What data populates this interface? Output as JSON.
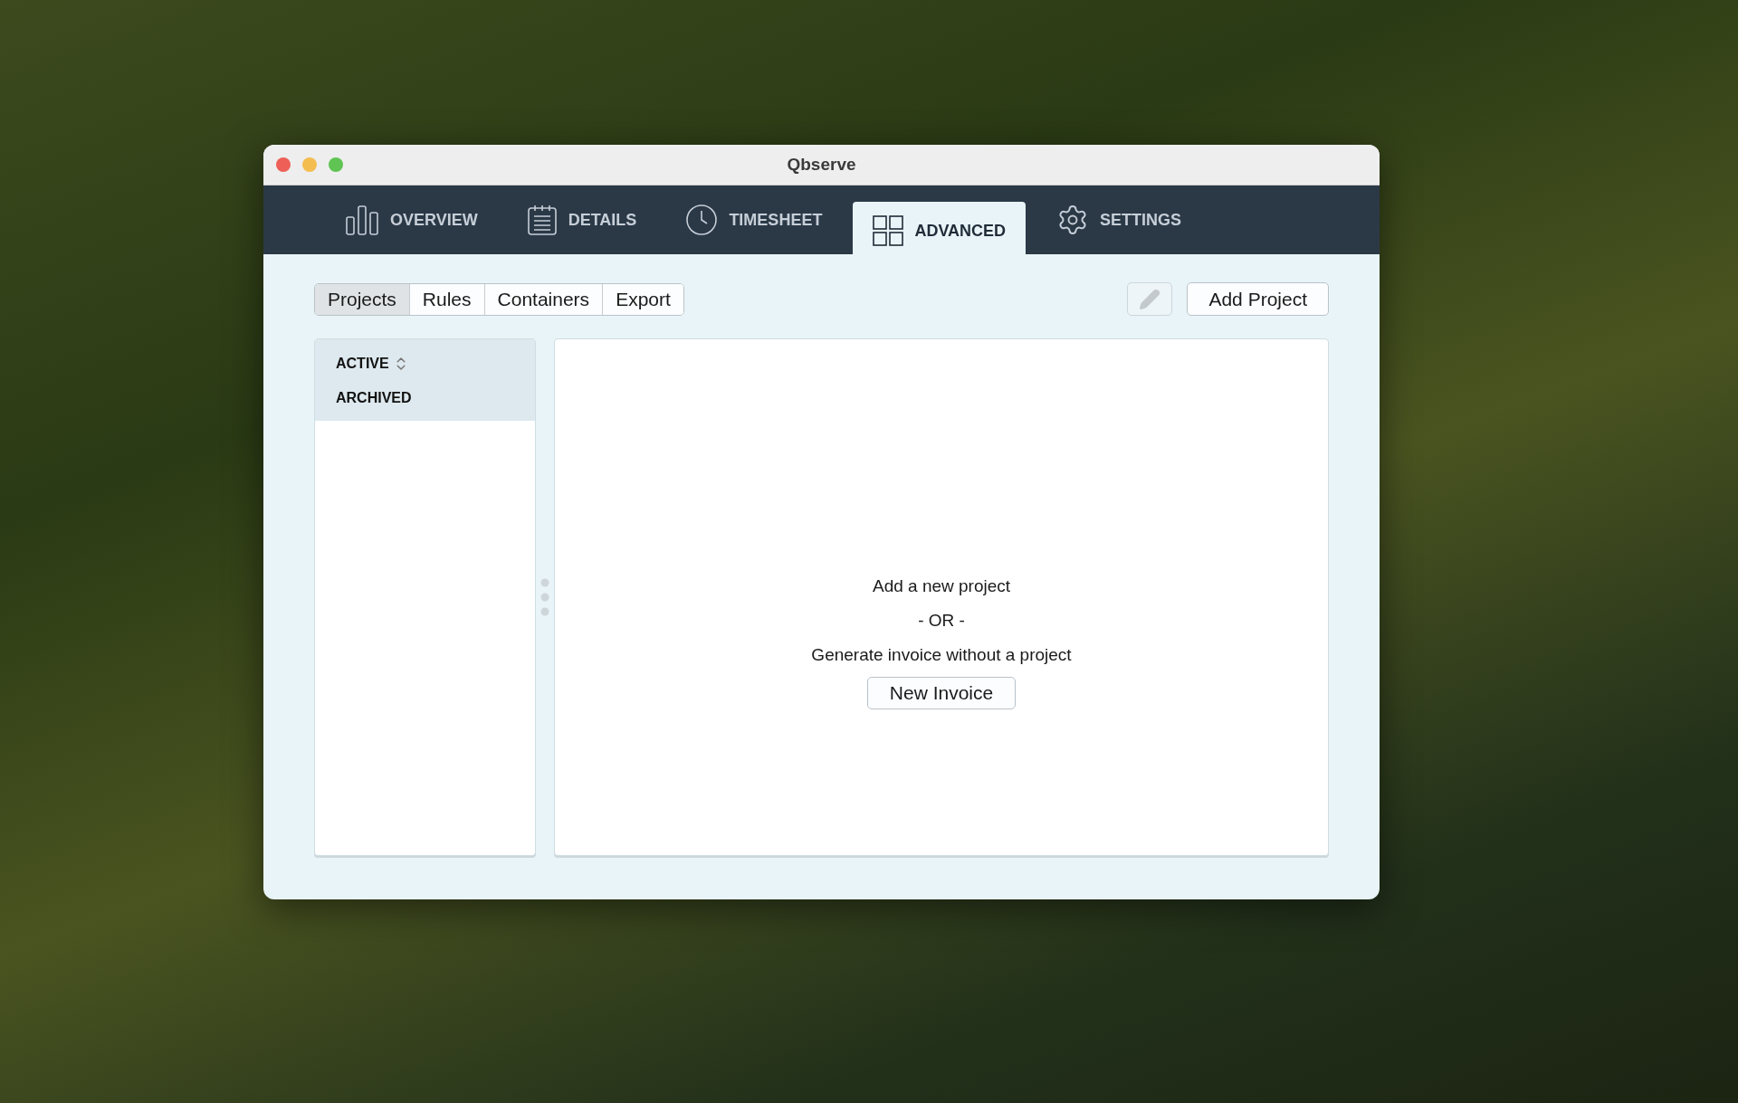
{
  "window": {
    "title": "Qbserve"
  },
  "nav_tabs": [
    {
      "label": "OVERVIEW",
      "kind": "chart",
      "selected": false
    },
    {
      "label": "DETAILS",
      "kind": "list",
      "selected": false
    },
    {
      "label": "TIMESHEET",
      "kind": "clock",
      "selected": false
    },
    {
      "label": "ADVANCED",
      "kind": "grid",
      "selected": true
    },
    {
      "label": "SETTINGS",
      "kind": "gear",
      "selected": false
    }
  ],
  "segments": [
    {
      "label": "Projects",
      "selected": true
    },
    {
      "label": "Rules",
      "selected": false
    },
    {
      "label": "Containers",
      "selected": false
    },
    {
      "label": "Export",
      "selected": false
    }
  ],
  "add_button": "Add Project",
  "sidebar": {
    "items": [
      {
        "label": "ACTIVE",
        "sortable": true
      },
      {
        "label": "ARCHIVED",
        "sortable": false
      }
    ]
  },
  "empty_state": {
    "line_1": "Add a new project",
    "separator": "- OR -",
    "line_2": "Generate invoice without a project",
    "button": "New Invoice"
  }
}
